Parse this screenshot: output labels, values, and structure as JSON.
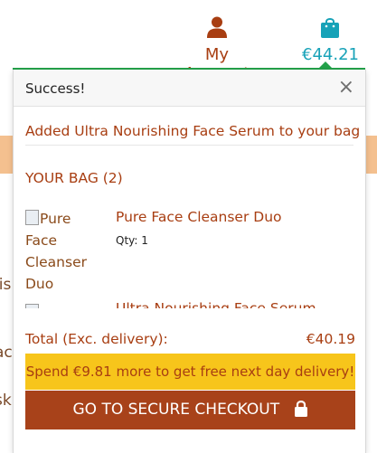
{
  "header": {
    "account_label": "My Account",
    "bag_total": "€44.21",
    "account_icon": "user-icon",
    "bag_icon": "shopping-bag-icon"
  },
  "background": {
    "fragments": [
      "lis",
      "ac",
      "sk"
    ]
  },
  "toast": {
    "title": "Success!",
    "close_glyph": "×",
    "message": "Added Ultra Nourishing Face Serum to your bag",
    "bag_title": "YOUR BAG (2)",
    "items": [
      {
        "image_alt": "Pure Face Cleanser Duo",
        "name": "Pure Face Cleanser Duo",
        "qty": "Qty: 1"
      },
      {
        "name": "Ultra Nourishing Face Serum"
      }
    ],
    "total_label": "Total (Exc. delivery):",
    "total_value": "€40.19",
    "promo": "Spend €9.81 more to get free next day delivery!",
    "checkout_label": "GO TO SECURE CHECKOUT"
  },
  "colors": {
    "brand": "#a83e12",
    "accent": "#17a2b8",
    "success": "#23a14a",
    "promo": "#f7c51b"
  }
}
